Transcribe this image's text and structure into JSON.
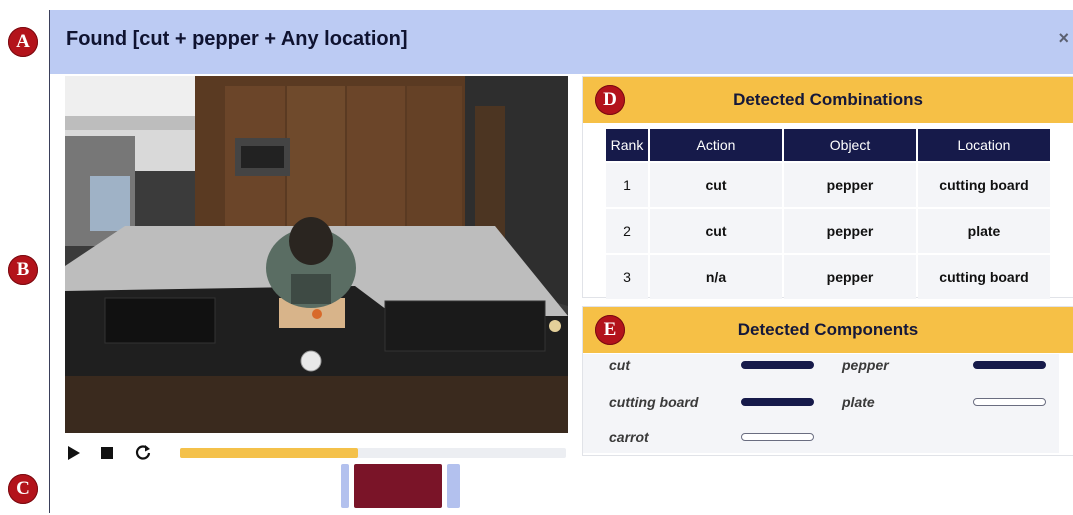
{
  "markers": [
    "A",
    "B",
    "C",
    "D",
    "E"
  ],
  "dialog": {
    "title": "Found [cut + pepper + Any location]",
    "close_label": "×"
  },
  "player": {
    "controls": [
      "play-icon",
      "stop-icon",
      "restart-icon"
    ],
    "progress_fraction": 0.46
  },
  "combinations": {
    "title": "Detected Combinations",
    "columns": [
      "Rank",
      "Action",
      "Object",
      "Location"
    ],
    "rows": [
      {
        "rank": "1",
        "action": "cut",
        "object": "pepper",
        "location": "cutting board"
      },
      {
        "rank": "2",
        "action": "cut",
        "object": "pepper",
        "location": "plate"
      },
      {
        "rank": "3",
        "action": "n/a",
        "object": "pepper",
        "location": "cutting board"
      }
    ]
  },
  "components": {
    "title": "Detected Components",
    "items": [
      {
        "label": "cut",
        "detected": true
      },
      {
        "label": "pepper",
        "detected": true
      },
      {
        "label": "cutting board",
        "detected": true
      },
      {
        "label": "plate",
        "detected": false
      },
      {
        "label": "carrot",
        "detected": false
      }
    ]
  },
  "colors": {
    "header": "#bccbf3",
    "accent": "#f6c046",
    "navy": "#161a4a",
    "marker": "#b3131b",
    "clip": "#7a1428"
  }
}
